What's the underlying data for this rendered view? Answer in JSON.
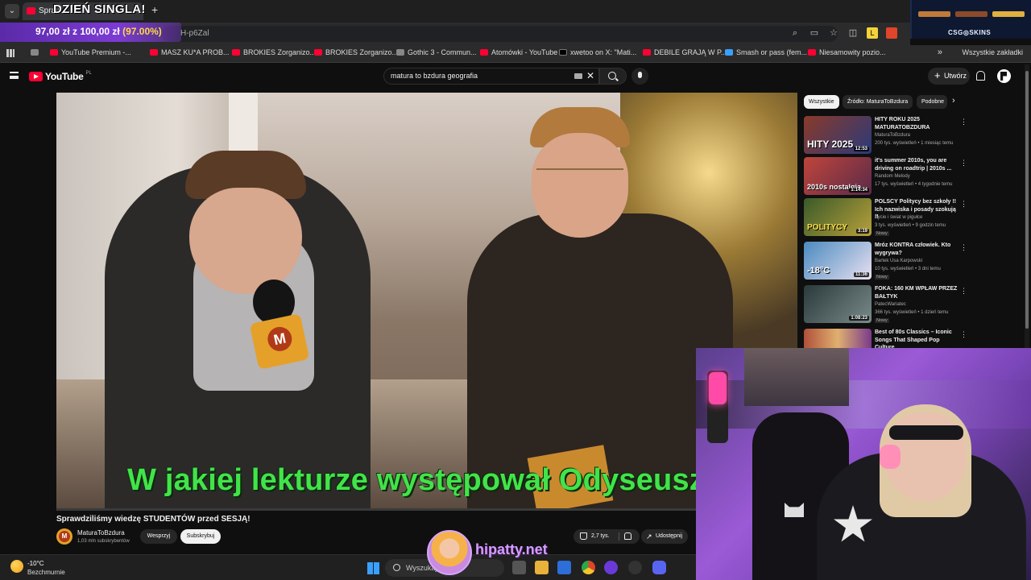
{
  "browser": {
    "tab_title": "Spraw...",
    "banner_text": "DZIEŃ SINGLA!",
    "url_fragment": "H-p6Zal",
    "bookmarks": [
      "YouTube Premium -...",
      "MASZ KU*A PROB...",
      "BROKIES Zorganizo...",
      "BROKIES Zorganizo...",
      "Gothic 3 - Commun...",
      "Atomówki - YouTube",
      "xwetoo on X: \"Mati...",
      "DEBILE GRAJĄ W P...",
      "Smash or pass (fem...",
      "Niesamowity pozio..."
    ],
    "all_bookmarks": "Wszystkie zakładki"
  },
  "donation": {
    "amount": "97,00 zł z 100,00 zł",
    "percent": "(97.00%)"
  },
  "sponsor": {
    "label": "CSG◎SKINS"
  },
  "youtube": {
    "logo_text": "YouTube",
    "region": "PL",
    "search_query": "matura to bzdura geografia",
    "create_label": "Utwórz"
  },
  "video": {
    "subtitle": "W jakiej lekturze występował Odyseusz",
    "title": "Sprawdziliśmy wiedzę STUDENTÓW przed SESJĄ!",
    "channel": "MaturaToBzdura",
    "subscribers": "1,03 mln subskrybentów",
    "support_label": "Wesprzyj",
    "subscribe_label": "Subskrybuj",
    "likes": "2,7 tys.",
    "share_label": "Udostępnij"
  },
  "chips": [
    "Wszystkie",
    "Źródło: MaturaToBzdura",
    "Podobne"
  ],
  "recommendations": [
    {
      "title": "HITY ROKU 2025 MATURATOBZDURA",
      "channel": "MaturaToBzdura",
      "meta": "200 tys. wyświetleń • 1 miesiąc temu",
      "duration": "12:53",
      "thumb_text": "HITY 2025",
      "badge": ""
    },
    {
      "title": "it's summer 2010s, you are driving on roadtrip | 2010s ...",
      "channel": "Random Melody",
      "meta": "17 tys. wyświetleń • 4 tygodnie temu",
      "duration": "1:14:34",
      "thumb_text": "2010s nostalgia",
      "badge": ""
    },
    {
      "title": "POLSCY Politycy bez szkoły !! Ich nazwiska i posady szokują !!",
      "channel": "Życie i świat w pigułce",
      "meta": "3 tys. wyświetleń • 9 godzin temu",
      "duration": "3:19",
      "thumb_text": "POLITYCY",
      "badge": "Nowy"
    },
    {
      "title": "Mróz KONTRA człowiek. Kto wygrywa?",
      "channel": "Bartek Usa Karpowski",
      "meta": "10 tys. wyświetleń • 3 dni temu",
      "duration": "11:36",
      "thumb_text": "-18°C",
      "badge": "Nowy"
    },
    {
      "title": "FOKA: 160 KM WPŁAW PRZEZ BAŁTYK",
      "channel": "PatecWariatec",
      "meta": "366 tys. wyświetleń • 1 dzień temu",
      "duration": "1:08:23",
      "thumb_text": "",
      "badge": "Nowy"
    },
    {
      "title": "Best of 80s Classics – Iconic Songs That Shaped Pop Culture",
      "channel": "",
      "meta": "",
      "duration": "",
      "thumb_text": "",
      "badge": ""
    }
  ],
  "taskbar": {
    "temperature": "-10°C",
    "condition": "Bezchmurnie",
    "search_placeholder": "Wyszukaj"
  },
  "overlay": {
    "brand": "hipatty.net"
  },
  "colors": {
    "youtube_red": "#ff0033",
    "subtitle_green": "#42e34a",
    "donation_purple": "#7c3bd4"
  }
}
